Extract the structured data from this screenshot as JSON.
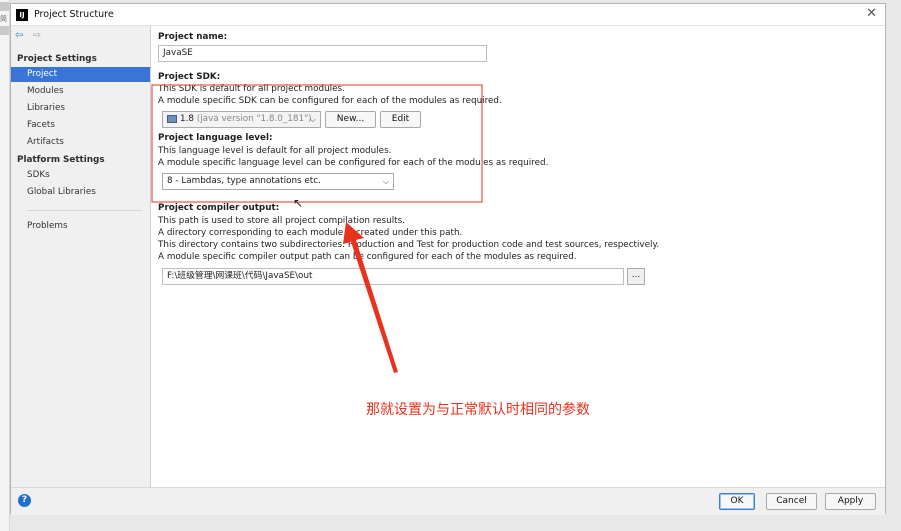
{
  "window": {
    "title": "Project Structure",
    "close_icon": "✕",
    "app_logo": "IJ"
  },
  "left_strip": {
    "fragment_text": "简"
  },
  "sidebar": {
    "nav_back": "⇦",
    "nav_forward": "⇨",
    "project_settings_header": "Project Settings",
    "project_settings_items": [
      "Project",
      "Modules",
      "Libraries",
      "Facets",
      "Artifacts"
    ],
    "platform_settings_header": "Platform Settings",
    "platform_settings_items": [
      "SDKs",
      "Global Libraries"
    ],
    "problems": "Problems",
    "active_item": "Project"
  },
  "project": {
    "name_label": "Project name:",
    "name_value": "JavaSE",
    "sdk_label": "Project SDK:",
    "sdk_desc_1": "This SDK is default for all project modules.",
    "sdk_desc_2": "A module specific SDK can be configured for each of the modules as required.",
    "sdk_version": "1.8",
    "sdk_detail": "(java version \"1.8.0_181\")",
    "new_button": "New...",
    "edit_button": "Edit",
    "lang_label": "Project language level:",
    "lang_desc_1": "This language level is default for all project modules.",
    "lang_desc_2": "A module specific language level can be configured for each of the modules as required.",
    "lang_value": "8 - Lambdas, type annotations etc.",
    "output_label": "Project compiler output:",
    "output_desc_1": "This path is used to store all project compilation results.",
    "output_desc_2": "A directory corresponding to each module is created under this path.",
    "output_desc_3": "This directory contains two subdirectories: Production and Test for production code and test sources, respectively.",
    "output_desc_4": "A module specific compiler output path can be configured for each of the modules as required.",
    "output_path": "F:\\班级管理\\网课班\\代码\\JavaSE\\out",
    "browse_button": "..."
  },
  "footer": {
    "help": "?",
    "ok": "OK",
    "cancel": "Cancel",
    "apply": "Apply"
  },
  "annotation": {
    "caption": "那就设置为与正常默认时相同的参数",
    "color": "#e8321e"
  },
  "colors": {
    "selection": "#3875d7",
    "sidebar_bg": "#f0f0f0",
    "accent": "#3c7fd1"
  }
}
